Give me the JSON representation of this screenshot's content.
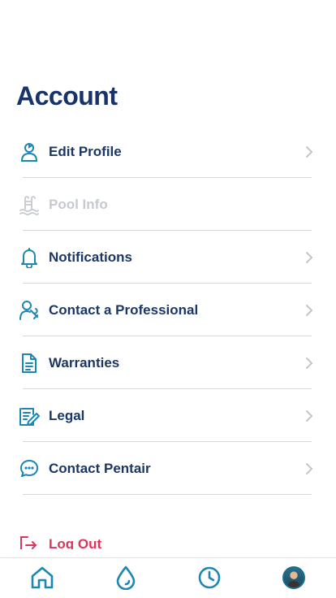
{
  "page": {
    "title": "Account"
  },
  "menu": {
    "items": [
      {
        "label": "Edit Profile",
        "icon": "user-profile-icon",
        "enabled": true
      },
      {
        "label": "Pool Info",
        "icon": "pool-ladder-icon",
        "enabled": false
      },
      {
        "label": "Notifications",
        "icon": "bell-icon",
        "enabled": true
      },
      {
        "label": "Contact a Professional",
        "icon": "professional-wrench-icon",
        "enabled": true
      },
      {
        "label": "Warranties",
        "icon": "document-icon",
        "enabled": true
      },
      {
        "label": "Legal",
        "icon": "legal-document-pen-icon",
        "enabled": true
      },
      {
        "label": "Contact Pentair",
        "icon": "chat-bubble-icon",
        "enabled": true
      }
    ]
  },
  "logout": {
    "label": "Log Out",
    "icon": "logout-icon"
  },
  "tabbar": {
    "tabs": [
      {
        "name": "home",
        "icon": "home-icon"
      },
      {
        "name": "water",
        "icon": "water-drop-icon"
      },
      {
        "name": "history",
        "icon": "clock-icon"
      },
      {
        "name": "account",
        "icon": "avatar"
      }
    ]
  },
  "colors": {
    "primary": "#1b3766",
    "accent": "#1b87b4",
    "disabled": "#c6c9cf",
    "danger": "#e0335a",
    "divider": "#d8d8d8"
  }
}
